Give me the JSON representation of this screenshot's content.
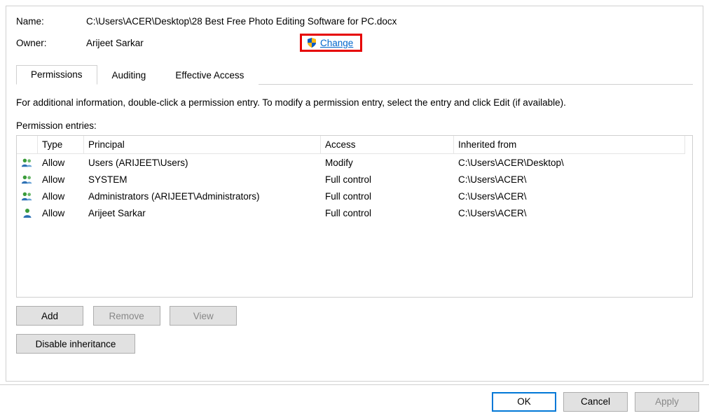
{
  "header": {
    "name_label": "Name:",
    "name_value": "C:\\Users\\ACER\\Desktop\\28 Best Free Photo Editing Software for PC.docx",
    "owner_label": "Owner:",
    "owner_value": "Arijeet Sarkar",
    "change_link": "Change"
  },
  "tabs": {
    "permissions": "Permissions",
    "auditing": "Auditing",
    "effective": "Effective Access"
  },
  "info_line": "For additional information, double-click a permission entry. To modify a permission entry, select the entry and click Edit (if available).",
  "perm_label": "Permission entries:",
  "columns": {
    "type": "Type",
    "principal": "Principal",
    "access": "Access",
    "inherited": "Inherited from"
  },
  "rows": [
    {
      "icon": "group",
      "type": "Allow",
      "principal": "Users (ARIJEET\\Users)",
      "access": "Modify",
      "inherited": "C:\\Users\\ACER\\Desktop\\"
    },
    {
      "icon": "group",
      "type": "Allow",
      "principal": "SYSTEM",
      "access": "Full control",
      "inherited": "C:\\Users\\ACER\\"
    },
    {
      "icon": "group",
      "type": "Allow",
      "principal": "Administrators (ARIJEET\\Administrators)",
      "access": "Full control",
      "inherited": "C:\\Users\\ACER\\"
    },
    {
      "icon": "user",
      "type": "Allow",
      "principal": "Arijeet Sarkar",
      "access": "Full control",
      "inherited": "C:\\Users\\ACER\\"
    }
  ],
  "buttons": {
    "add": "Add",
    "remove": "Remove",
    "view": "View",
    "disable_inh": "Disable inheritance",
    "ok": "OK",
    "cancel": "Cancel",
    "apply": "Apply"
  }
}
